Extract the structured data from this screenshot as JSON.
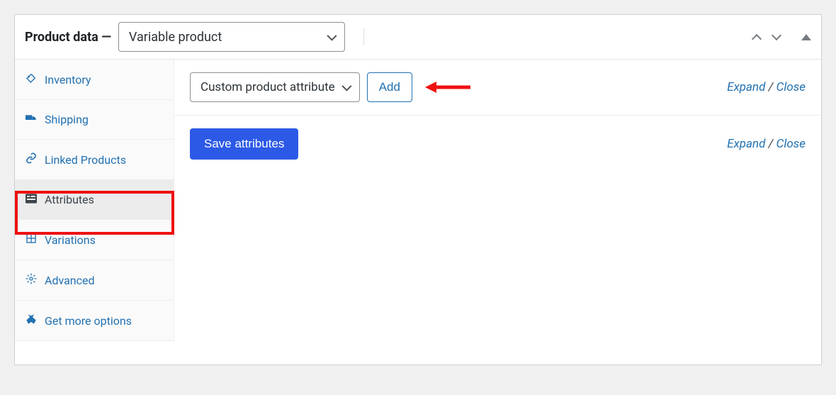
{
  "header": {
    "title": "Product data —",
    "product_type": "Variable product"
  },
  "sidebar": {
    "items": [
      {
        "label": "Inventory",
        "icon": "inventory-icon",
        "active": false
      },
      {
        "label": "Shipping",
        "icon": "shipping-icon",
        "active": false
      },
      {
        "label": "Linked Products",
        "icon": "linked-products-icon",
        "active": false
      },
      {
        "label": "Attributes",
        "icon": "attributes-icon",
        "active": true
      },
      {
        "label": "Variations",
        "icon": "variations-icon",
        "active": false
      },
      {
        "label": "Advanced",
        "icon": "advanced-icon",
        "active": false
      },
      {
        "label": "Get more options",
        "icon": "get-more-icon",
        "active": false
      }
    ]
  },
  "toolbar": {
    "attribute_select": "Custom product attribute",
    "add_button": "Add",
    "expand_label": "Expand",
    "close_label": "Close",
    "slash": " / "
  },
  "save": {
    "button": "Save attributes"
  }
}
